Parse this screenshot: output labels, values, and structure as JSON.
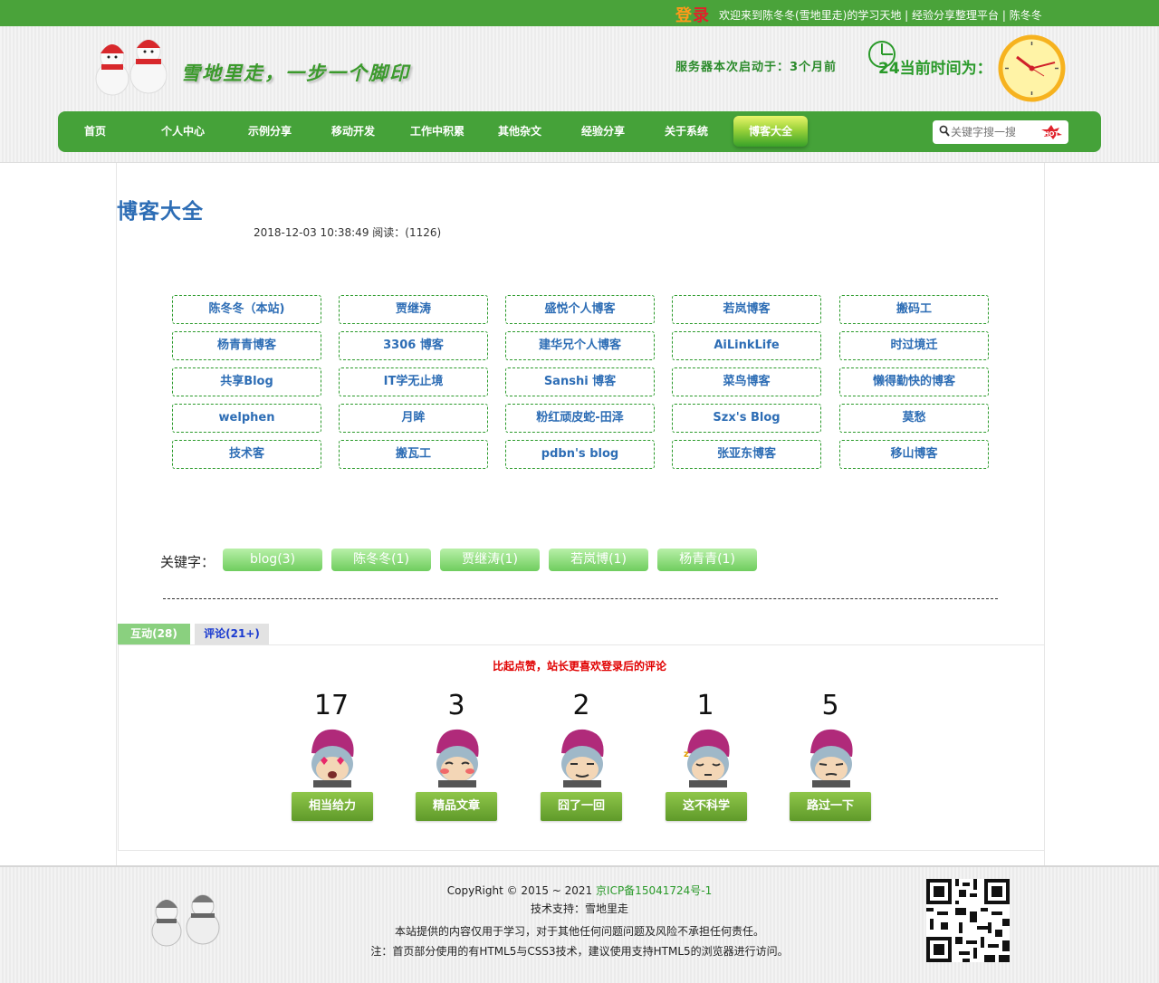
{
  "topbar": {
    "login_a": "登",
    "login_b": "录",
    "welcome": "欢迎来到陈冬冬(雪地里走)的学习天地 | 经验分享整理平台 | 陈冬冬"
  },
  "header": {
    "slogan": "雪地里走，一步一个脚印",
    "server_started": "服务器本次启动于：3个月前",
    "current_time_label": "24当前时间为："
  },
  "nav": {
    "items": [
      "首页",
      "个人中心",
      "示例分享",
      "移动开发",
      "工作中积累",
      "其他杂文",
      "经验分享",
      "关于系统",
      "博客大全"
    ],
    "active": "博客大全",
    "search_placeholder": "关键字搜一搜",
    "hot_label": "HOT"
  },
  "article": {
    "title": "博客大全",
    "meta": "2018-12-03 10:38:49 阅读：(1126)"
  },
  "blogs": [
    "陈冬冬（本站)",
    "贾继涛",
    "盛悦个人博客",
    "若岚博客",
    "搬码工",
    "杨青青博客",
    "3306 博客",
    "建华兄个人博客",
    "AiLinkLife",
    "时过境迁",
    "共享Blog",
    "IT学无止境",
    "Sanshi 博客",
    "菜鸟博客",
    "懒得勤快的博客",
    "welphen",
    "月眸",
    "粉红顽皮蛇-田泽",
    "Szx's Blog",
    "莫愁",
    "技术客",
    "搬瓦工",
    "pdbn's blog",
    "张亚东博客",
    "移山博客"
  ],
  "keywords": {
    "label": "关键字：",
    "tags": [
      "blog(3)",
      "陈冬冬(1)",
      "贾继涛(1)",
      "若岚博(1)",
      "杨青青(1)"
    ]
  },
  "tabs": {
    "interact": "互动(28)",
    "comments": "评论(21+)"
  },
  "reactions": {
    "hint": "比起点赞，站长更喜欢登录后的评论",
    "items": [
      {
        "count": "17",
        "label": "相当给力"
      },
      {
        "count": "3",
        "label": "精品文章"
      },
      {
        "count": "2",
        "label": "囧了一回"
      },
      {
        "count": "1",
        "label": "这不科学"
      },
      {
        "count": "5",
        "label": "路过一下"
      }
    ]
  },
  "footer": {
    "copyright": "CopyRight © 2015 ~ 2021",
    "icp": "京ICP备15041724号-1",
    "support": "技术支持：雪地里走",
    "disclaimer": "本站提供的内容仅用于学习，对于其他任何问题问题及风险不承担任何责任。",
    "note": "注：首页部分使用的有HTML5与CSS3技术，建议使用支持HTML5的浏览器进行访问。"
  },
  "colors": {
    "brand_green": "#45a239",
    "link_blue": "#2d6db5",
    "hint_red": "#e00000"
  }
}
